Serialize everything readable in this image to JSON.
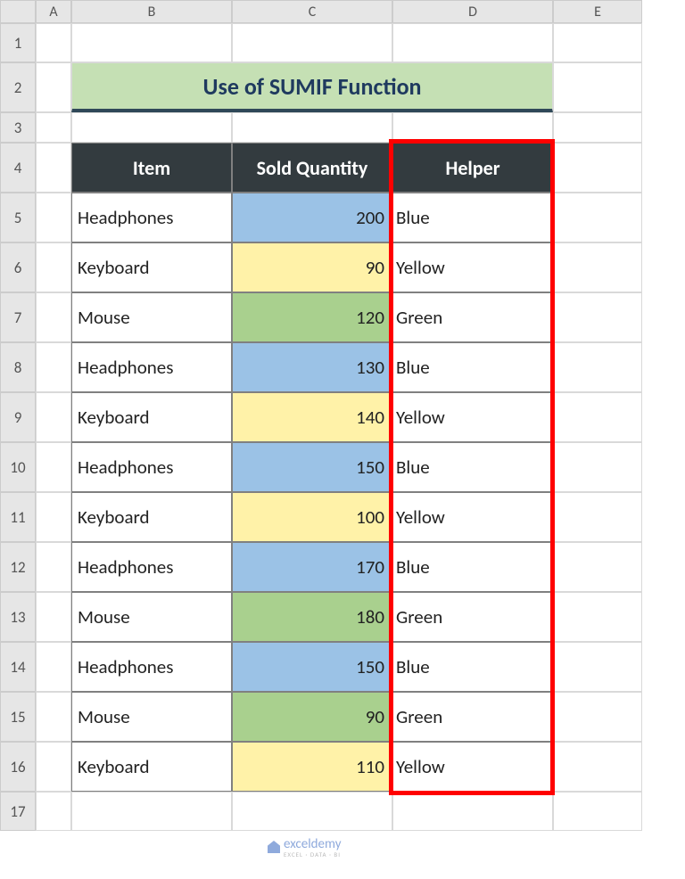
{
  "columns": [
    "A",
    "B",
    "C",
    "D",
    "E"
  ],
  "rows": [
    "1",
    "2",
    "3",
    "4",
    "5",
    "6",
    "7",
    "8",
    "9",
    "10",
    "11",
    "12",
    "13",
    "14",
    "15",
    "16",
    "17"
  ],
  "title": "Use of SUMIF Function",
  "headers": {
    "item": "Item",
    "qty": "Sold Quantity",
    "helper": "Helper"
  },
  "data": [
    {
      "item": "Headphones",
      "qty": "200",
      "helper": "Blue",
      "fill": "fill-blue"
    },
    {
      "item": "Keyboard",
      "qty": "90",
      "helper": "Yellow",
      "fill": "fill-yellow"
    },
    {
      "item": "Mouse",
      "qty": "120",
      "helper": "Green",
      "fill": "fill-green"
    },
    {
      "item": "Headphones",
      "qty": "130",
      "helper": "Blue",
      "fill": "fill-blue"
    },
    {
      "item": "Keyboard",
      "qty": "140",
      "helper": "Yellow",
      "fill": "fill-yellow"
    },
    {
      "item": "Headphones",
      "qty": "150",
      "helper": "Blue",
      "fill": "fill-blue"
    },
    {
      "item": "Keyboard",
      "qty": "100",
      "helper": "Yellow",
      "fill": "fill-yellow"
    },
    {
      "item": "Headphones",
      "qty": "170",
      "helper": "Blue",
      "fill": "fill-blue"
    },
    {
      "item": "Mouse",
      "qty": "180",
      "helper": "Green",
      "fill": "fill-green"
    },
    {
      "item": "Headphones",
      "qty": "150",
      "helper": "Blue",
      "fill": "fill-blue"
    },
    {
      "item": "Mouse",
      "qty": "90",
      "helper": "Green",
      "fill": "fill-green"
    },
    {
      "item": "Keyboard",
      "qty": "110",
      "helper": "Yellow",
      "fill": "fill-yellow"
    }
  ],
  "watermark": {
    "main": "exceldemy",
    "sub": "EXCEL · DATA · BI"
  },
  "chart_data": {
    "type": "table",
    "title": "Use of SUMIF Function",
    "columns": [
      "Item",
      "Sold Quantity",
      "Helper"
    ],
    "rows": [
      [
        "Headphones",
        200,
        "Blue"
      ],
      [
        "Keyboard",
        90,
        "Yellow"
      ],
      [
        "Mouse",
        120,
        "Green"
      ],
      [
        "Headphones",
        130,
        "Blue"
      ],
      [
        "Keyboard",
        140,
        "Yellow"
      ],
      [
        "Headphones",
        150,
        "Blue"
      ],
      [
        "Keyboard",
        100,
        "Yellow"
      ],
      [
        "Headphones",
        170,
        "Blue"
      ],
      [
        "Mouse",
        180,
        "Green"
      ],
      [
        "Headphones",
        150,
        "Blue"
      ],
      [
        "Mouse",
        90,
        "Green"
      ],
      [
        "Keyboard",
        110,
        "Yellow"
      ]
    ]
  }
}
